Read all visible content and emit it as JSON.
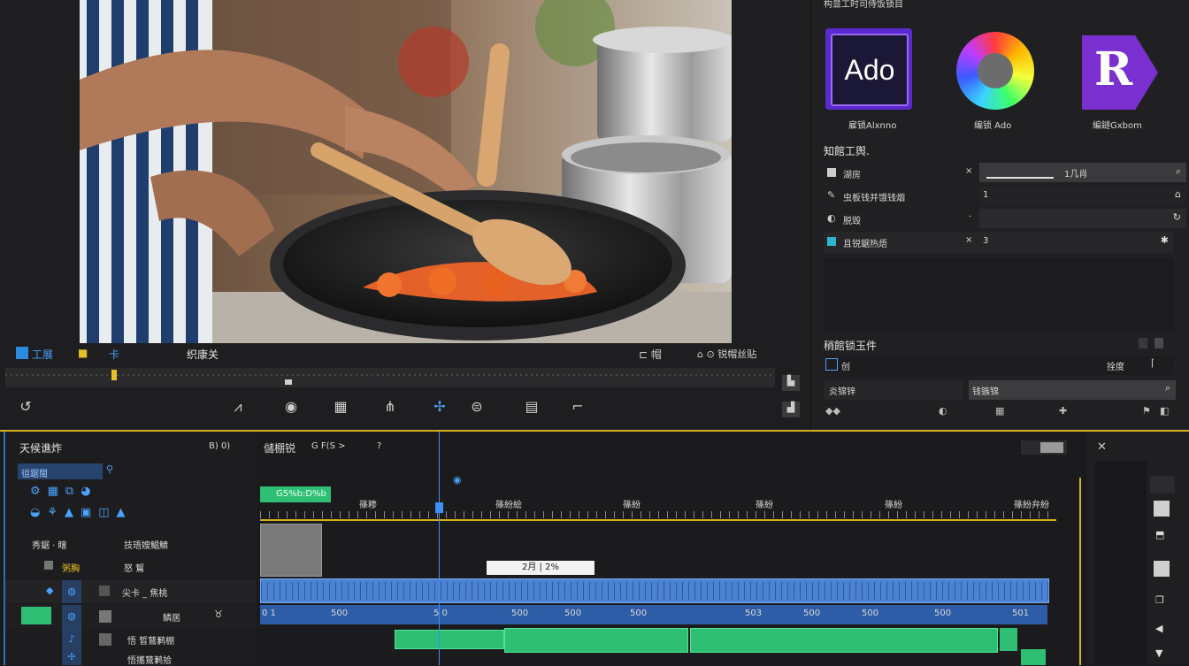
{
  "monitor": {
    "left_tab_1": "工展",
    "left_tab_2": "■",
    "left_tab_3": "卡",
    "center_label": "织康关",
    "right_label_1": "⊏ 帽",
    "right_label_2": "⌂ ⊙ 锐帽丝贴"
  },
  "right_panel": {
    "header": "构显工时司侍饭锁目",
    "apps": [
      {
        "name": "雇锁Alxnno",
        "logo_text": "Ado",
        "color": "#7b3fe0"
      },
      {
        "name": "编锁 Ado",
        "logo_text": "",
        "color": "#e0e0e0"
      },
      {
        "name": "編鐩Gxbom",
        "logo_text": "R",
        "color": "#7f2fd0"
      }
    ],
    "tools_title": "知館工舆.",
    "props": [
      {
        "label": "湖房",
        "x": "×",
        "value": "1几肖",
        "icon": "search-icon"
      },
      {
        "label": "虫板钱并饿钱烟",
        "x": "",
        "value": "1",
        "icon": "home-icon"
      },
      {
        "label": "脱毁",
        "x": "·",
        "value": "",
        "icon": "refresh-icon"
      },
      {
        "label": "且锐鋸热焐",
        "x": "×",
        "value": "3",
        "icon": "star-icon"
      }
    ],
    "assets_title": "稍館锁玉件",
    "assets_sub_left": "创",
    "assets_sub_right": "拴度",
    "asset_search_label": "炎锦锌",
    "asset_search_value": "钱镞锦"
  },
  "timeline": {
    "panel_title": "天候谯炸",
    "panel_meta": "B) 0)",
    "track_search": "徂踞閩",
    "seq_title": "儲棚锐",
    "seq_meta": "G F(S >",
    "seq_meta_2": "?",
    "timecode_label": "G5%b:D%b",
    "ruler_labels": [
      "篠糁",
      "篠紛絵",
      "篠紛",
      "篠紛",
      "篠紛",
      "篠紛",
      "篠紛弁紛"
    ],
    "time_box": "2月 | 2%",
    "v_track_labels": [
      "秀鋸 · 瞎",
      "技珸嫂鯧鯖",
      "粥胸",
      "怒 鴽"
    ],
    "a_track_labels": [
      "尖卡 _ 焦桃",
      "鳞居",
      "悟 晳鶿鹣棚",
      "悟攜鶿鹣拾"
    ],
    "clip_numbers": [
      "0 1",
      "500",
      "5 0",
      "500",
      "500",
      "500",
      "500",
      "503",
      "500",
      "500",
      "500",
      "501"
    ]
  }
}
